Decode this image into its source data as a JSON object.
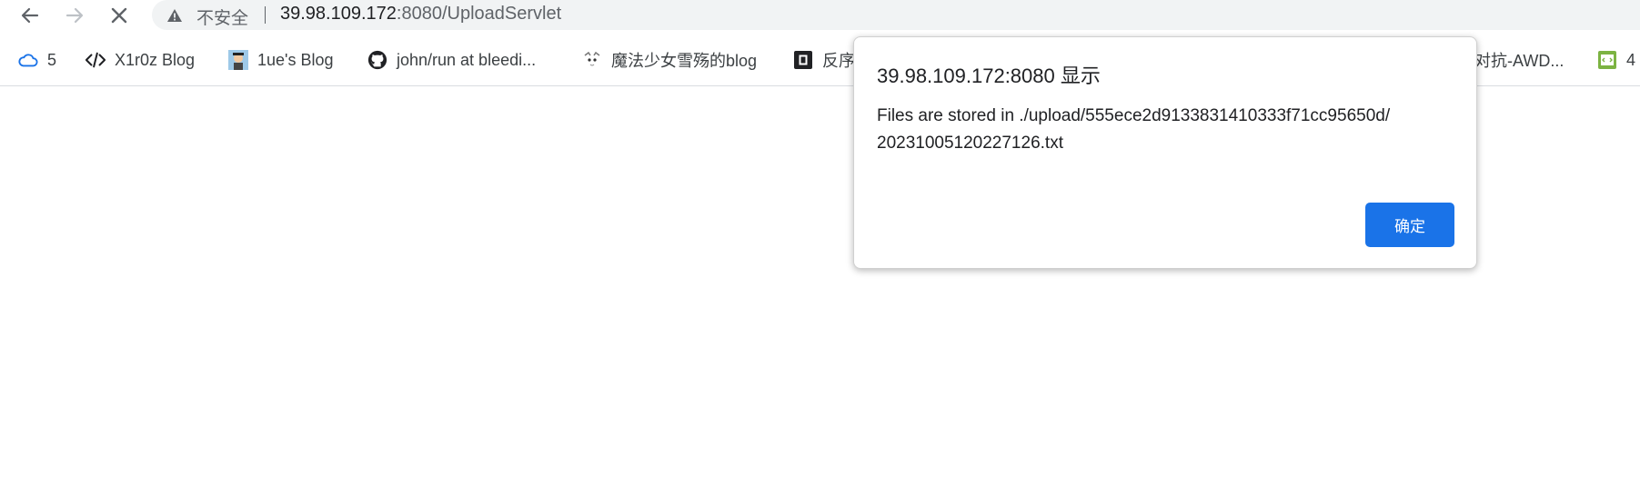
{
  "browser": {
    "omnibox": {
      "security_label": "不安全",
      "url_host": "39.98.109.172",
      "url_rest": ":8080/UploadServlet"
    },
    "bookmarks": [
      {
        "label": "5",
        "icon": "cloud-icon"
      },
      {
        "label": "X1r0z Blog",
        "icon": "code-icon"
      },
      {
        "label": "1ue's Blog",
        "icon": "avatar-icon"
      },
      {
        "label": "john/run at bleedi...",
        "icon": "github-icon"
      },
      {
        "label": "魔法少女雪殇的blog",
        "icon": "anime-avatar-icon"
      },
      {
        "label": "反序",
        "icon": "square-icon"
      },
      {
        "label": "对抗-AWD...",
        "icon": ""
      },
      {
        "label": "4",
        "icon": "code-page-icon"
      }
    ]
  },
  "dialog": {
    "title": "39.98.109.172:8080 显示",
    "message_line1": "Files are stored in ./upload/555ece2d9133831410333f71cc95650d/",
    "message_line2": "20231005120227126.txt",
    "ok_label": "确定"
  },
  "colors": {
    "accent": "#1a73e8",
    "omnibox_bg": "#f1f3f4",
    "cloud_icon": "#1a73e8",
    "code_page_icon": "#7cb342"
  }
}
